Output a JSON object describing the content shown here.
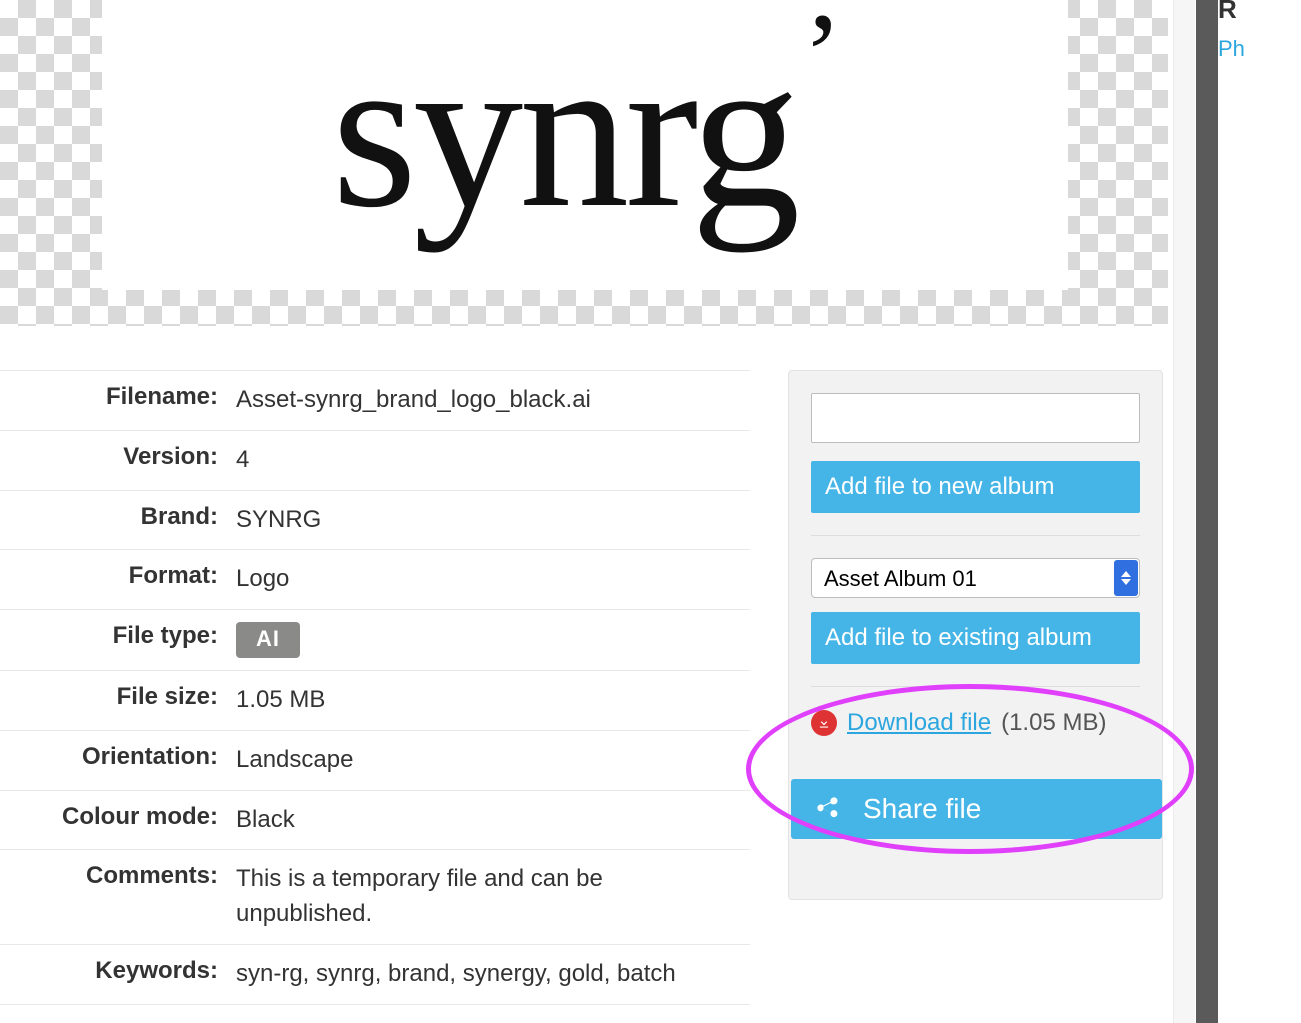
{
  "preview": {
    "logo_text": "synrg",
    "logo_glyph": "’"
  },
  "meta": [
    {
      "label": "Filename:",
      "value": "Asset-synrg_brand_logo_black.ai"
    },
    {
      "label": "Version:",
      "value": "4"
    },
    {
      "label": "Brand:",
      "value": "SYNRG"
    },
    {
      "label": "Format:",
      "value": "Logo"
    },
    {
      "label": "File type:",
      "value": "AI",
      "badge": true
    },
    {
      "label": "File size:",
      "value": "1.05 MB"
    },
    {
      "label": "Orientation:",
      "value": "Landscape"
    },
    {
      "label": "Colour mode:",
      "value": "Black"
    },
    {
      "label": "Comments:",
      "value": "This is a temporary file and can be unpublished."
    },
    {
      "label": "Keywords:",
      "value": "syn-rg, synrg, brand, synergy, gold, batch"
    }
  ],
  "panel": {
    "new_album_input": "",
    "add_new_label": "Add file to new album",
    "existing_album_selected": "Asset Album 01",
    "add_existing_label": "Add file to existing album",
    "download_link_text": "Download file",
    "download_size": "(1.05 MB)",
    "share_label": "Share file"
  },
  "sidebar": {
    "heading_fragment": "R",
    "link_fragment": "Ph"
  }
}
